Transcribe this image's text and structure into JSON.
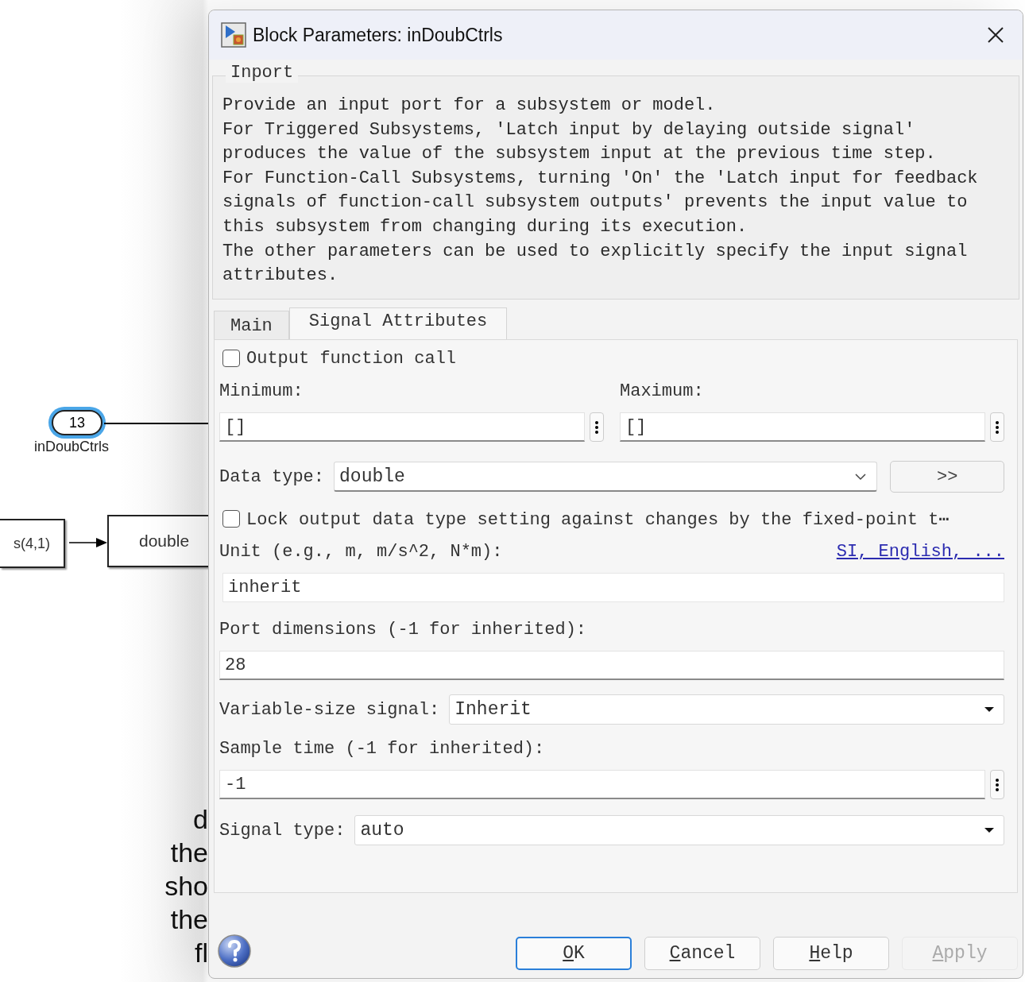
{
  "canvas": {
    "port": {
      "number": "13",
      "name": "inDoubCtrls",
      "selected": true
    },
    "blocks": [
      {
        "label": "s(4,1)"
      },
      {
        "label": "double"
      }
    ],
    "text_fragments": [
      "d",
      "the",
      "sho",
      "the",
      "fl"
    ]
  },
  "dialog": {
    "title": "Block Parameters: inDoubCtrls",
    "group": {
      "legend": "Inport",
      "description": "Provide an input port for a subsystem or model.\nFor Triggered Subsystems, 'Latch input by delaying outside signal'\nproduces the value of the subsystem input at the previous time step.\nFor Function-Call Subsystems, turning 'On' the 'Latch input for feedback\nsignals of function-call subsystem outputs' prevents the input value to\nthis subsystem from changing during its execution.\nThe other parameters can be used to explicitly specify the input signal\nattributes."
    },
    "tabs": [
      {
        "label": "Main",
        "selected": false
      },
      {
        "label": "Signal Attributes",
        "selected": true
      }
    ],
    "output_function_call": {
      "label": "Output function call",
      "checked": false
    },
    "minimum": {
      "label": "Minimum:",
      "value": "[]"
    },
    "maximum": {
      "label": "Maximum:",
      "value": "[]"
    },
    "data_type": {
      "label": "Data type:",
      "value": "double",
      "assistant": ">>"
    },
    "lock": {
      "label": "Lock output data type setting against changes by the fixed-point t⋯",
      "checked": false
    },
    "unit": {
      "label": "Unit (e.g., m, m/s^2, N*m):",
      "link": "SI, English, ...",
      "value": "inherit"
    },
    "port_dimensions": {
      "label": "Port dimensions (-1 for inherited):",
      "value": "28"
    },
    "variable_size": {
      "label": "Variable-size signal:",
      "value": "Inherit"
    },
    "sample_time": {
      "label": "Sample time (-1 for inherited):",
      "value": "-1"
    },
    "signal_type": {
      "label": "Signal type:",
      "value": "auto"
    },
    "buttons": [
      {
        "accel": "O",
        "rest": "K",
        "default": true,
        "disabled": false
      },
      {
        "accel": "C",
        "rest": "ancel",
        "default": false,
        "disabled": false
      },
      {
        "accel": "H",
        "rest": "elp",
        "default": false,
        "disabled": false
      },
      {
        "accel": "A",
        "rest": "pply",
        "default": false,
        "disabled": true
      }
    ]
  }
}
